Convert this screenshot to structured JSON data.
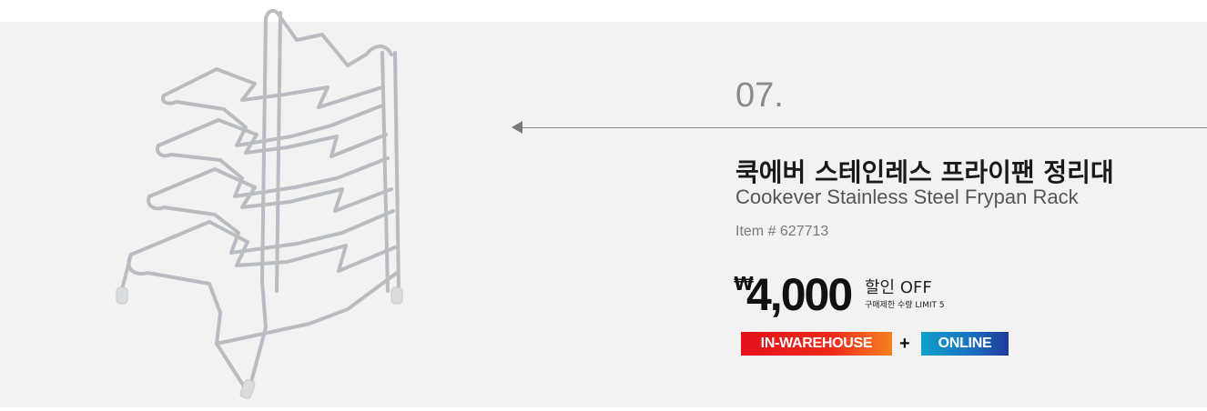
{
  "product": {
    "number": "07.",
    "title_ko": "쿡에버 스테인레스 프라이팬 정리대",
    "title_en": "Cookever Stainless Steel Frypan Rack",
    "item_code": "Item # 627713"
  },
  "price": {
    "currency": "₩",
    "amount": "4,000",
    "discount_label": "할인 OFF",
    "limit_label": "구매제한 수량 LIMIT 5"
  },
  "badges": {
    "warehouse": "IN-WAREHOUSE",
    "plus": "+",
    "online": "ONLINE"
  },
  "colors": {
    "panel_background": "#f2f2f2",
    "warehouse_badge": "#e3111b",
    "online_badge": "#1b73c2"
  },
  "icons": {
    "arrow": "left-arrow-icon"
  }
}
